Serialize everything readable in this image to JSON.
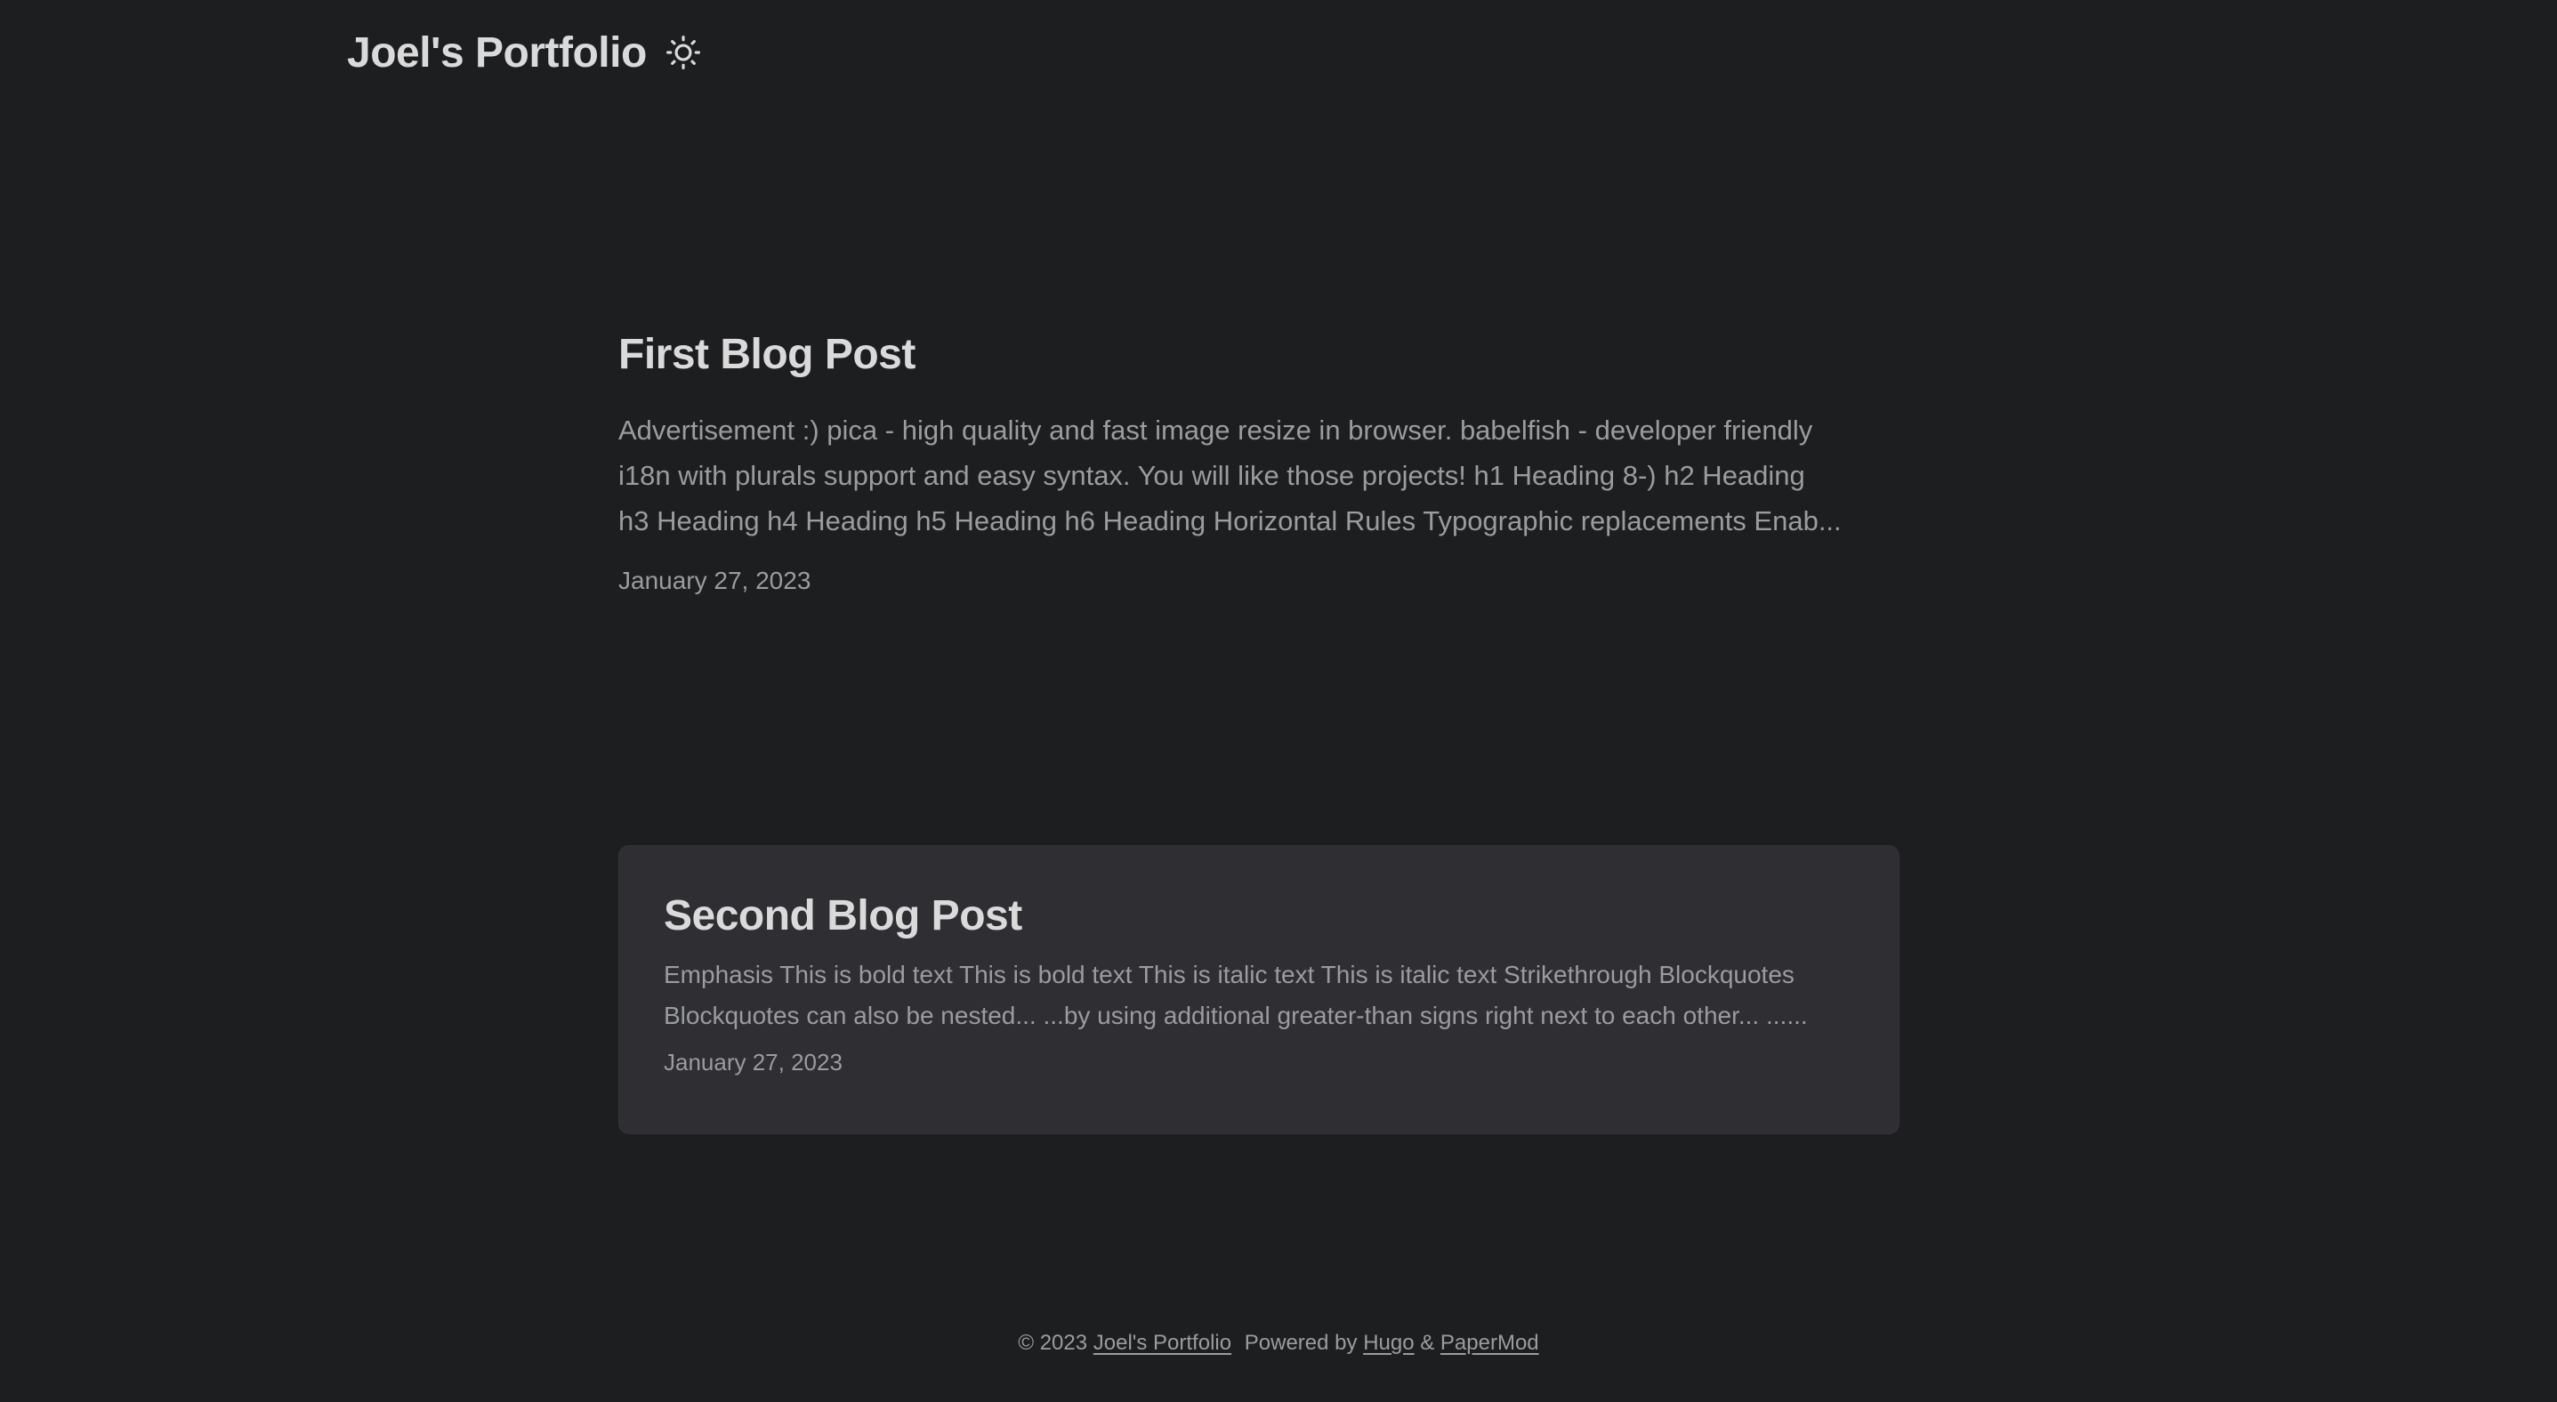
{
  "header": {
    "site_title": "Joel's Portfolio",
    "theme_toggle_icon": "sun-icon"
  },
  "posts": [
    {
      "title": "First Blog Post",
      "excerpt_lines": [
        "Advertisement :) pica - high quality and fast image resize in browser. babelfish - developer friendly",
        "i18n with plurals support and easy syntax. You will like those projects! h1 Heading 8-) h2 Heading",
        "h3 Heading h4 Heading h5 Heading h6 Heading Horizontal Rules Typographic replacements Enab..."
      ],
      "date": "January 27, 2023"
    },
    {
      "title": "Second Blog Post",
      "excerpt_lines": [
        "Emphasis This is bold text This is bold text This is italic text This is italic text Strikethrough Blockquotes",
        "Blockquotes can also be nested... ...by using additional greater-than signs right next to each other... ......"
      ],
      "date": "January 27, 2023"
    }
  ],
  "footer": {
    "copyright": "© 2023",
    "site_link": "Joel's Portfolio",
    "powered_by": "Powered by",
    "hugo_link": "Hugo",
    "ampersand": "&",
    "papermod_link": "PaperMod"
  },
  "colors": {
    "background": "#1d1e20",
    "card_background": "#2e2e33",
    "primary_text": "#dadadb",
    "secondary_text": "#9b9c9d"
  }
}
